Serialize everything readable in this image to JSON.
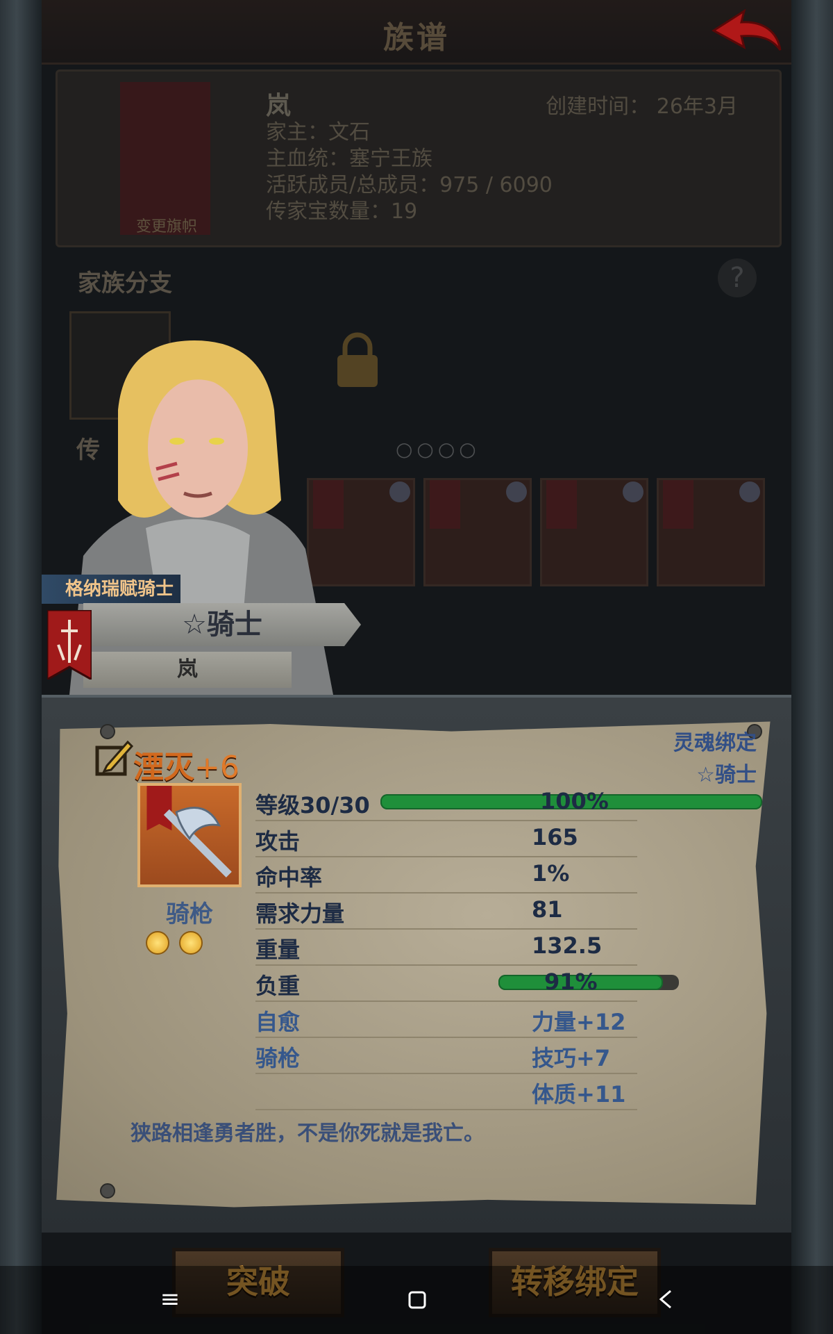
{
  "header": {
    "title": "族谱"
  },
  "family": {
    "banner_label": "变更旗帜",
    "name": "岚",
    "created_label": "创建时间：",
    "created_value": "26年3月",
    "head": "家主：文石",
    "bloodline": "主血统：塞宁王族",
    "members": "活跃成员/总成员：975 / 6090",
    "heirloom_count": "传家宝数量：19"
  },
  "branches": {
    "title": "家族分支",
    "help": "?"
  },
  "heirlooms": {
    "title": "传",
    "dots": "○○○○"
  },
  "hero": {
    "class_ribbon": "格纳瑞赋骑士",
    "rank": "☆骑士",
    "family_name": "岚"
  },
  "weapon": {
    "name": "湮灭",
    "plus": "+6",
    "type": "骑枪",
    "gem_count": 2,
    "soul_bind": "灵魂绑定",
    "bind_rank": "☆骑士",
    "stats": [
      {
        "label": "等级30/30",
        "value": "100%",
        "bar_fill": 1.0
      },
      {
        "label": "攻击",
        "value": "165"
      },
      {
        "label": "命中率",
        "value": "1%"
      },
      {
        "label": "需求力量",
        "value": "81"
      },
      {
        "label": "重量",
        "value": "132.5"
      },
      {
        "label": "负重",
        "value": "91%",
        "bar_fill": 0.91
      }
    ],
    "traits": [
      {
        "label": "自愈",
        "value": "力量+12"
      },
      {
        "label": "骑枪",
        "value": "技巧+7"
      },
      {
        "label": "",
        "value": "体质+11"
      }
    ],
    "flavor": "狭路相逢勇者胜，不是你死就是我亡。"
  },
  "actions": {
    "breakthrough": "突破",
    "transfer": "转移绑定"
  },
  "colors": {
    "accent": "#d2691e",
    "bar_green": "#1f8f3a",
    "text_blue": "#35578c"
  }
}
